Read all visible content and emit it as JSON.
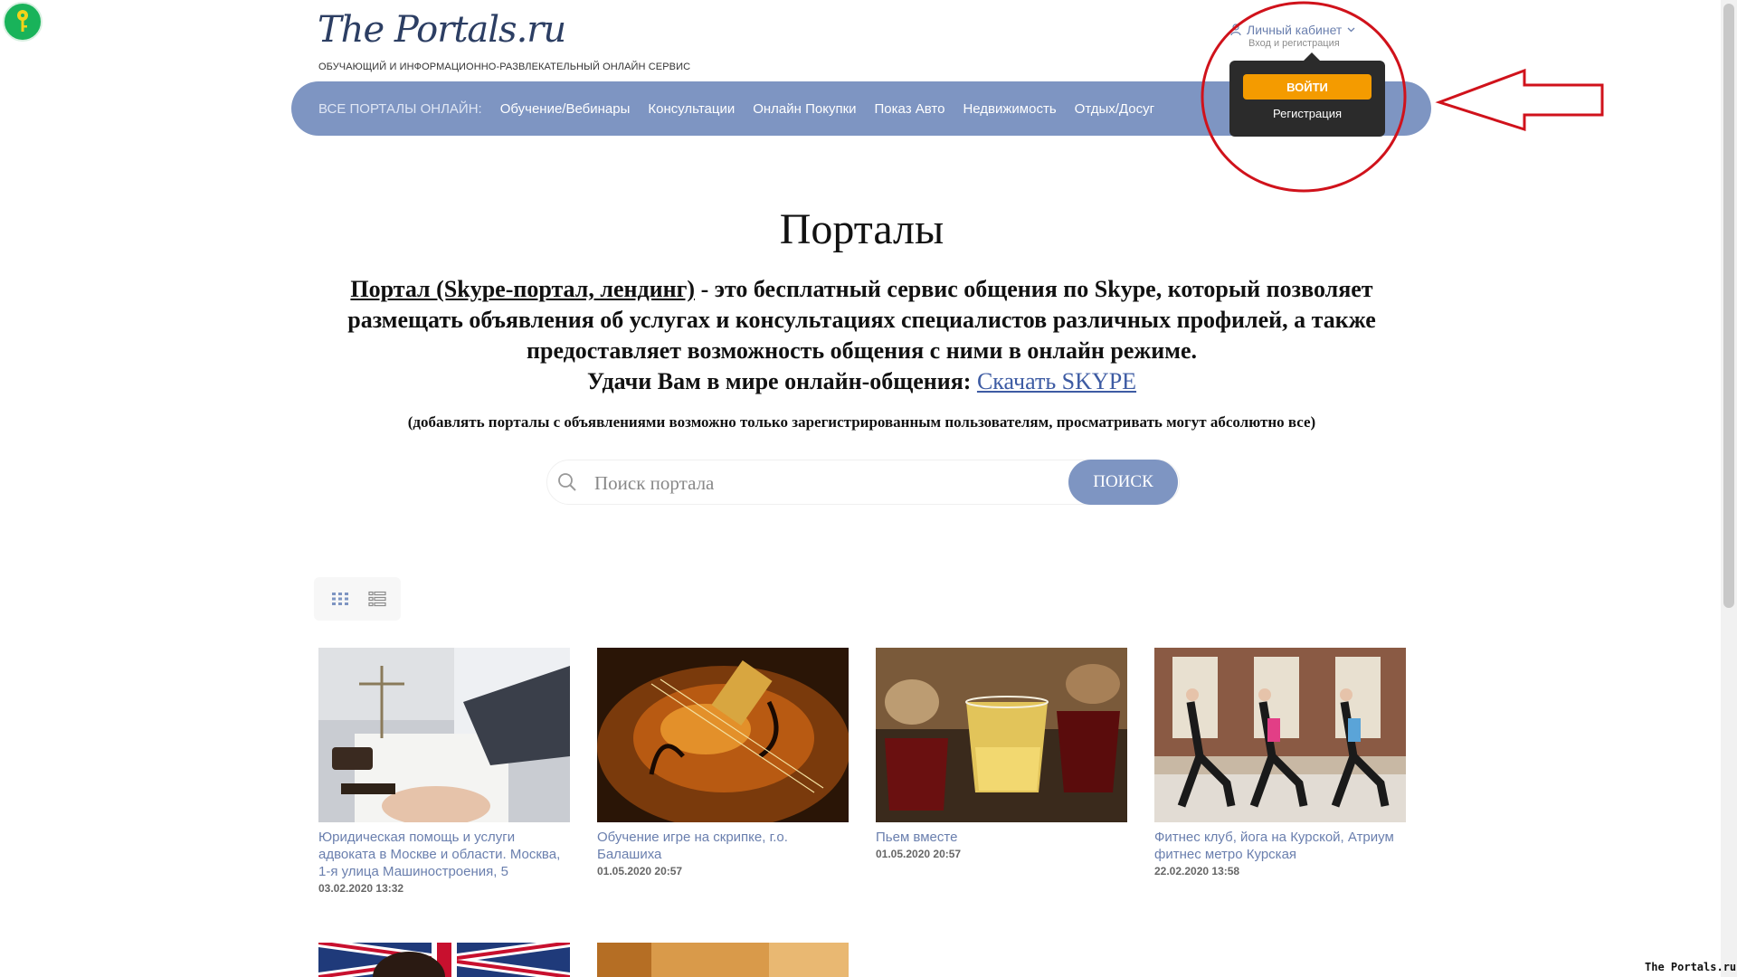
{
  "brand": {
    "logo": "The Portals.ru",
    "tagline": "ОБУЧАЮЩИЙ И ИНФОРМАЦИОННО-РАЗВЛЕКАТЕЛЬНЫЙ ОНЛАЙН СЕРВИС"
  },
  "account": {
    "title": "Личный кабинет",
    "subtitle": "Вход и регистрация",
    "login_label": "ВОЙТИ",
    "register_label": "Регистрация"
  },
  "nav": {
    "prefix": "ВСЕ ПОРТАЛЫ ОНЛАЙН:",
    "items": [
      "Обучение/Вебинары",
      "Консультации",
      "Онлайн Покупки",
      "Показ Авто",
      "Недвижимость",
      "Отдых/Досуг"
    ]
  },
  "page": {
    "heading": "Порталы",
    "desc_link": "Портал (Skype-портал, лендинг)",
    "desc_text": " - это бесплатный сервис общения по Skype, который позволяет размещать объявления об услугах и консультациях специалистов различных профилей, а также предоставляет возможность общения с ними в онлайн режиме.",
    "wish_text": "Удачи Вам в мире онлайн-общения: ",
    "skype_link": "Скачать SKYPE",
    "note": "(добавлять порталы с объявлениями возможно только зарегистрированным пользователям, просматривать могут абсолютно все)"
  },
  "search": {
    "placeholder": "Поиск портала",
    "button": "ПОИСК"
  },
  "cards": [
    {
      "title": "Юридическая помощь и услуги адвоката в Москве и области. Москва, 1-я улица Машиностроения, 5",
      "date": "03.02.2020 13:32"
    },
    {
      "title": "Обучение игре на скрипке, г.о. Балашиха",
      "date": "01.05.2020 20:57"
    },
    {
      "title": "Пьем вместе",
      "date": "01.05.2020 20:57"
    },
    {
      "title": "Фитнес клуб, йога на Курской, Атриум фитнес метро Курская",
      "date": "22.02.2020 13:58"
    }
  ],
  "watermark": "The Portals.ru",
  "colors": {
    "nav_bg": "#7e95c2",
    "accent_orange": "#f49b00",
    "annotation_red": "#d0121b",
    "link": "#6a7fae"
  }
}
